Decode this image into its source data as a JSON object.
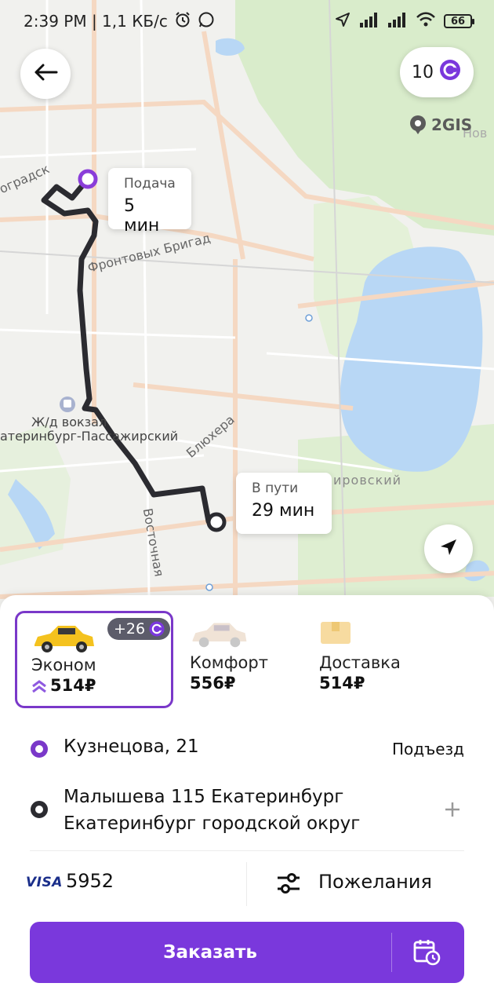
{
  "status_bar": {
    "time_data": "2:39 PM | 1,1 КБ/с",
    "battery": "66"
  },
  "map": {
    "bonus_count": "10",
    "provider_logo": "2GIS",
    "pickup_bubble": {
      "title": "Подача",
      "value": "5 мин"
    },
    "trip_bubble": {
      "title": "В пути",
      "value": "29 мин"
    },
    "labels": {
      "street_1": "Фронтовых Бригад",
      "street_2": "Блюхера",
      "street_3": "Восточная",
      "street_4": "оградск",
      "station_1": "Ж/д вокзал",
      "station_2": "атеринбург-Пассажирский",
      "district": "ировский",
      "corner": "Нов"
    },
    "colors": {
      "route": "#2b2b30",
      "lake": "#b8d7f5",
      "park": "#d7ecc9"
    }
  },
  "tariffs": [
    {
      "name": "Эконом",
      "price": "514₽",
      "bonus": "+26",
      "selected": true
    },
    {
      "name": "Комфорт",
      "price": "556₽",
      "selected": false
    },
    {
      "name": "Доставка",
      "price": "514₽",
      "selected": false
    }
  ],
  "route": {
    "from": "Кузнецова, 21",
    "entrance": "Подъезд",
    "to": "Малышева 115 Екатеринбург Екатеринбург городской округ"
  },
  "payment": {
    "card_brand": "VISA",
    "card_last4": "5952"
  },
  "wishes_label": "Пожелания",
  "order_button": "Заказать",
  "accent_color": "#7a38dc",
  "icons": [
    "back-arrow-icon",
    "bonus-coin-icon",
    "locate-icon",
    "plus-icon",
    "sliders-icon",
    "calendar-clock-icon",
    "car-icon",
    "box-icon"
  ]
}
